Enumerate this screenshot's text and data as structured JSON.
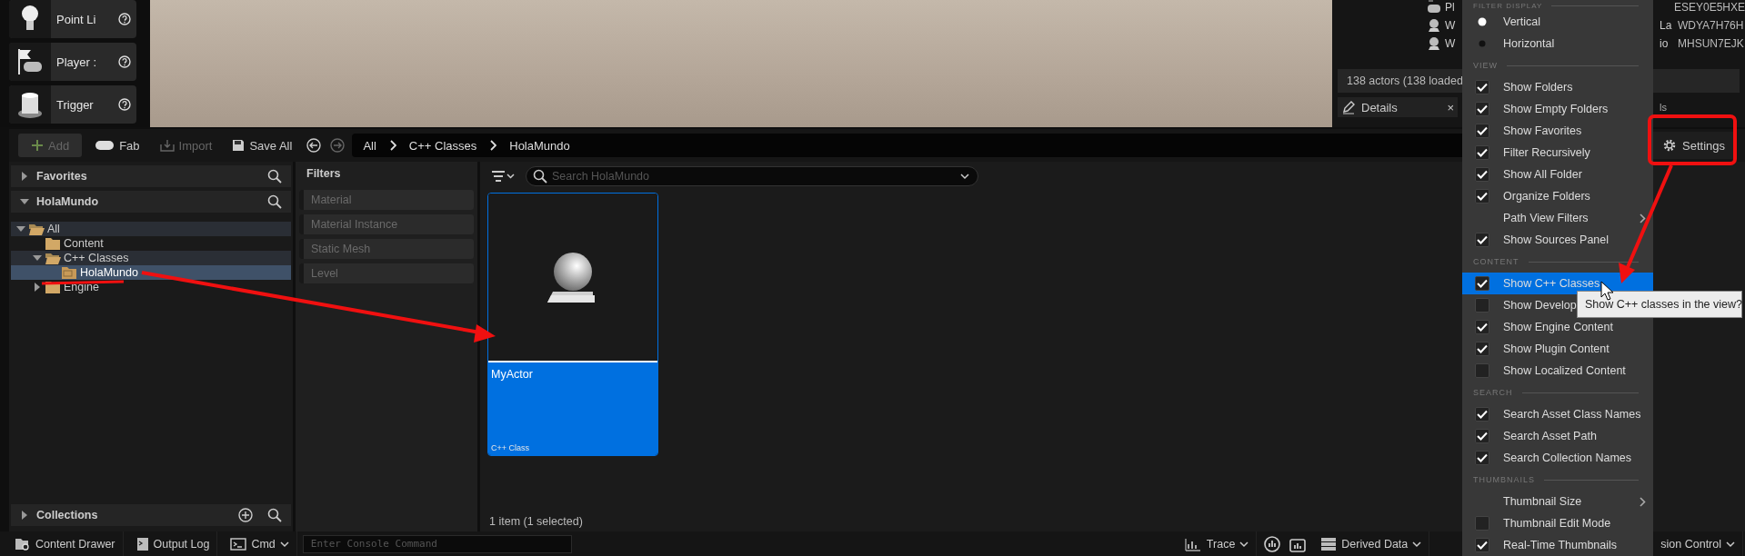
{
  "place_actors": [
    {
      "kind": "bulb",
      "label": "Point Li"
    },
    {
      "kind": "player",
      "label": "Player :"
    },
    {
      "kind": "trigger",
      "label": "Trigger"
    }
  ],
  "outliner": {
    "rows": [
      {
        "kind": "player",
        "name": "Pl",
        "fragment": "",
        "id": "ESEY0E5HXE"
      },
      {
        "kind": "actor",
        "name": "W",
        "fragment": "La",
        "id": "WDYA7H76H"
      },
      {
        "kind": "actor",
        "name": "W",
        "fragment": "io",
        "id": "MHSUN7EJK"
      }
    ],
    "status": "138 actors (138 loaded",
    "tabs": [
      {
        "label": "Details",
        "close": "×"
      },
      {
        "label": "ls"
      }
    ]
  },
  "toolbar": {
    "buttons": [
      {
        "kind": "add",
        "label": "Add",
        "disabled": true
      },
      {
        "kind": "fab",
        "label": "Fab",
        "disabled": false
      },
      {
        "kind": "import",
        "label": "Import",
        "disabled": true
      },
      {
        "kind": "save",
        "label": "Save All",
        "disabled": false
      }
    ],
    "path": [
      "All",
      "C++ Classes",
      "HolaMundo"
    ],
    "settings": "Settings"
  },
  "sources": {
    "favorites": "Favorites",
    "project": "HolaMundo",
    "tree": [
      {
        "label": "All",
        "expanded": true,
        "selected": false,
        "children": [
          {
            "label": "Content",
            "selected": false
          },
          {
            "label": "C++ Classes",
            "expanded": true,
            "selected": false,
            "children": [
              {
                "label": "HolaMundo",
                "kind": "cpp",
                "selected": true
              }
            ]
          },
          {
            "label": "Engine",
            "expanded": false,
            "selected": false
          }
        ]
      }
    ],
    "collections": "Collections"
  },
  "filters": {
    "title": "Filters",
    "items": [
      "Material",
      "Material Instance",
      "Static Mesh",
      "Level"
    ]
  },
  "assets": {
    "search_placeholder": "Search HolaMundo",
    "items": [
      {
        "name": "MyActor",
        "type": "C++ Class",
        "selected": true
      }
    ],
    "count": "1 item (1 selected)"
  },
  "settings_menu": {
    "items": [
      {
        "kind": "header",
        "label": "FILTER DISPLAY"
      },
      {
        "kind": "radio",
        "label": "Vertical",
        "selected": true
      },
      {
        "kind": "radio",
        "label": "Horizontal",
        "selected": false
      },
      {
        "kind": "header",
        "label": "VIEW"
      },
      {
        "kind": "check",
        "label": "Show Folders",
        "checked": true
      },
      {
        "kind": "check",
        "label": "Show Empty Folders",
        "checked": true
      },
      {
        "kind": "check",
        "label": "Show Favorites",
        "checked": true
      },
      {
        "kind": "check",
        "label": "Filter Recursively",
        "checked": true
      },
      {
        "kind": "check",
        "label": "Show All Folder",
        "checked": true
      },
      {
        "kind": "check",
        "label": "Organize Folders",
        "checked": true
      },
      {
        "kind": "submenu",
        "label": "Path View Filters"
      },
      {
        "kind": "check",
        "label": "Show Sources Panel",
        "checked": true
      },
      {
        "kind": "header",
        "label": "CONTENT"
      },
      {
        "kind": "check",
        "label": "Show C++ Classes",
        "checked": true,
        "hovered": true
      },
      {
        "kind": "check",
        "label": "Show Develop",
        "checked": false
      },
      {
        "kind": "check",
        "label": "Show Engine Content",
        "checked": true
      },
      {
        "kind": "check",
        "label": "Show Plugin Content",
        "checked": true
      },
      {
        "kind": "check",
        "label": "Show Localized Content",
        "checked": false
      },
      {
        "kind": "header",
        "label": "SEARCH"
      },
      {
        "kind": "check",
        "label": "Search Asset Class Names",
        "checked": true
      },
      {
        "kind": "check",
        "label": "Search Asset Path",
        "checked": true
      },
      {
        "kind": "check",
        "label": "Search Collection Names",
        "checked": true
      },
      {
        "kind": "header",
        "label": "THUMBNAILS"
      },
      {
        "kind": "submenu",
        "label": "Thumbnail Size"
      },
      {
        "kind": "check",
        "label": "Thumbnail Edit Mode",
        "checked": false
      },
      {
        "kind": "check",
        "label": "Real-Time Thumbnails",
        "checked": true
      }
    ],
    "tooltip": "Show C++ classes in the view?"
  },
  "status_bar": {
    "left": [
      {
        "kind": "drawer",
        "label": "Content Drawer"
      },
      {
        "kind": "log",
        "label": "Output Log"
      },
      {
        "kind": "cmd",
        "label": "Cmd"
      }
    ],
    "console_placeholder": "Enter Console Command",
    "right": [
      {
        "kind": "trace",
        "label": "Trace"
      },
      {
        "kind": "derived",
        "label": "Derived Data"
      },
      {
        "kind": "revision",
        "label": "sion Control"
      }
    ]
  }
}
